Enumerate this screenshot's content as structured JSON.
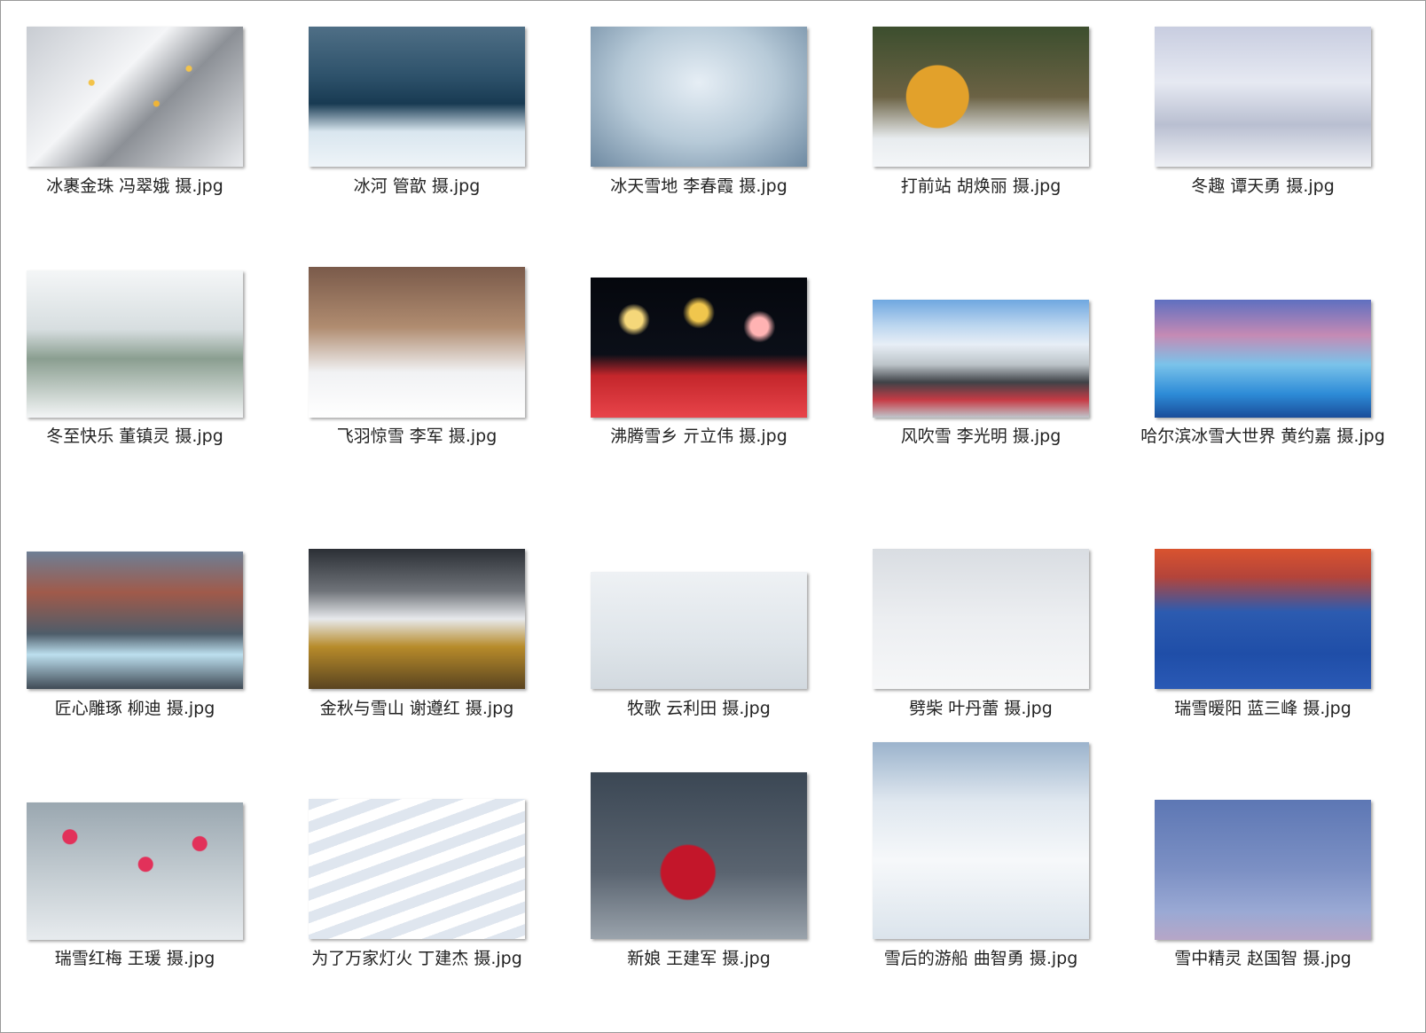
{
  "files": [
    {
      "name": "冰裹金珠  冯翠娥 摄.jpg",
      "art": "t0"
    },
    {
      "name": "冰河  管歆 摄.jpg",
      "art": "t1"
    },
    {
      "name": "冰天雪地  李春霞 摄.jpg",
      "art": "t2"
    },
    {
      "name": "打前站  胡焕丽 摄.jpg",
      "art": "t3"
    },
    {
      "name": "冬趣  谭天勇 摄.jpg",
      "art": "t4"
    },
    {
      "name": "冬至快乐  董镇灵 摄.jpg",
      "art": "t5"
    },
    {
      "name": "飞羽惊雪   李军 摄.jpg",
      "art": "t6"
    },
    {
      "name": "沸腾雪乡  亓立伟 摄.jpg",
      "art": "t7"
    },
    {
      "name": "风吹雪  李光明 摄.jpg",
      "art": "t8"
    },
    {
      "name": "哈尔滨冰雪大世界  黄约嘉 摄.jpg",
      "art": "t9"
    },
    {
      "name": "匠心雕琢  柳迪 摄.jpg",
      "art": "t10"
    },
    {
      "name": "金秋与雪山  谢遵红 摄.jpg",
      "art": "t11"
    },
    {
      "name": "牧歌  云利田 摄.jpg",
      "art": "t12"
    },
    {
      "name": "劈柴  叶丹蕾 摄.jpg",
      "art": "t13"
    },
    {
      "name": "瑞雪暖阳  蓝三峰 摄.jpg",
      "art": "t14"
    },
    {
      "name": "瑞雪红梅  王瑗 摄.jpg",
      "art": "t15"
    },
    {
      "name": "为了万家灯火  丁建杰 摄.jpg",
      "art": "t16"
    },
    {
      "name": "新娘  王建军 摄.jpg",
      "art": "t17"
    },
    {
      "name": "雪后的游船  曲智勇 摄.jpg",
      "art": "t18"
    },
    {
      "name": "雪中精灵  赵国智 摄.jpg",
      "art": "t19"
    }
  ]
}
